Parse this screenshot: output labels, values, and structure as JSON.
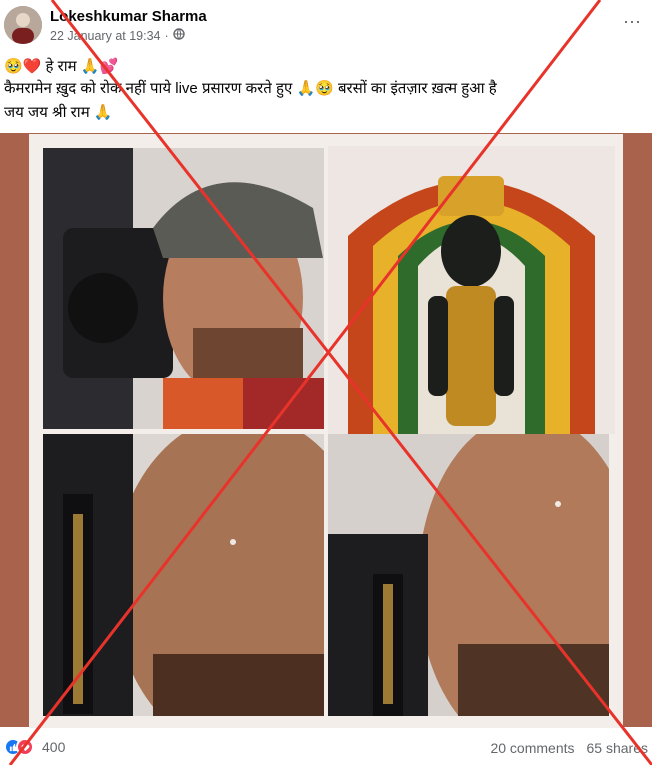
{
  "post": {
    "author": "Lokeshkumar Sharma",
    "timestamp": "22 January at 19:34",
    "audience_icon": "globe-icon",
    "more_icon": "more-options-icon",
    "text_line1": "🥹❤️ हे राम 🙏💕",
    "text_line2": "कैमरामेन ख़ुद को रोक नहीं पाये live प्रसारण करते हुए 🙏🥹 बरसों का इंतज़ार ख़त्म हुआ है",
    "text_line3": "जय जय श्री राम 🙏"
  },
  "image": {
    "tiles": [
      {
        "name": "crying-cameraman-cap"
      },
      {
        "name": "ram-lalla-idol"
      },
      {
        "name": "cameraman-tears-closeup-left"
      },
      {
        "name": "cameraman-tears-closeup-right"
      }
    ],
    "overlay": "red-cross-mark",
    "colors": {
      "frame": "#a9624c",
      "cross": "#e8332b"
    }
  },
  "footer": {
    "reaction_icons": [
      "like-icon",
      "love-icon"
    ],
    "reaction_count": "400",
    "comments": "20 comments",
    "shares": "65 shares"
  }
}
